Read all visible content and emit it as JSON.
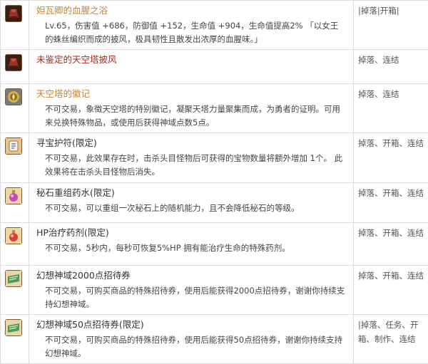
{
  "colors": {
    "name_gold": "#c8832a",
    "name_red": "#b02818",
    "name_dark": "#333333",
    "border": "#dcdcdc",
    "desc_text": "#444444"
  },
  "items": [
    {
      "name": "妲瓦卿的血腥之浴",
      "name_color": "#c8832a",
      "icon": "red-cloak-icon",
      "desc": "Lv.65，伤害值 +686，防御值 +152，生命值 +904，生命值提高2% 「以女王的蛛丝编织而成的披风，极具韧性且散发出浓厚的血腥味。」",
      "source": "|掉落|开箱|"
    },
    {
      "name": "未鉴定的天空塔披风",
      "name_color": "#b02818",
      "icon": "red-cloak-icon",
      "desc": "",
      "source": "掉落、连结"
    },
    {
      "name": "天空塔的徽记",
      "name_color": "#c8832a",
      "icon": "emblem-icon",
      "desc": "不可交易，象徵天空塔的特别徽记，凝聚天塔力量聚集而成，为勇者的证明。可用来兑换特殊物品，或使用后获得神域点数5点。",
      "source": "掉落、连结"
    },
    {
      "name": "寻宝护符(限定)",
      "name_color": "#333333",
      "icon": "amulet-icon",
      "desc": "不可交易，此效果存在时，击杀头目怪物后可获得的宝物数量将额外增加 1个。 此效果将在击杀头目怪物后消失。",
      "source": "掉落、开箱、连结"
    },
    {
      "name": "秘石重组药水(限定)",
      "name_color": "#333333",
      "icon": "potion-icon",
      "desc": "不可交易，可以重组一次秘石上的随机能力，且不会降低秘石的等级。",
      "source": "掉落、开箱、连结"
    },
    {
      "name": "HP治疗药剂(限定)",
      "name_color": "#333333",
      "icon": "hp-potion-icon",
      "desc": "不可交易，5秒内，每秒可恢复5%HP 拥有能治疗生命的特殊药剂。",
      "source": "掉落、开箱、连结"
    },
    {
      "name": "幻想神域2000点招待券",
      "name_color": "#333333",
      "icon": "ticket-icon",
      "desc": "不可交易，可购买商品的特殊招待券，使用后能获得2000点招待券，谢谢你持续支持幻想神域。",
      "source": "掉落、开箱、连结"
    },
    {
      "name": "幻想神域50点招待券(限定)",
      "name_color": "#333333",
      "icon": "ticket-icon",
      "desc": "不可交易，可购买商品的特殊招待券，使用后能获得50点招待券，谢谢你持续支持幻想神域。",
      "source": "|掉落、任务、开箱、制作、连结"
    }
  ]
}
